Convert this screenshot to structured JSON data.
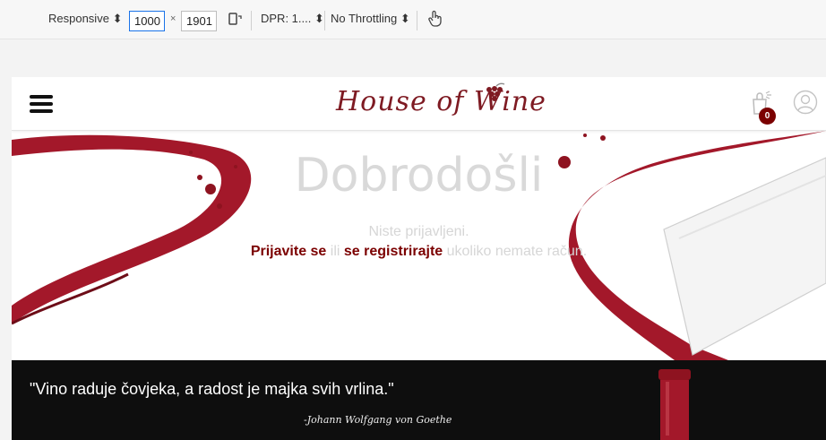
{
  "devtools": {
    "device": "Responsive",
    "width": "1000",
    "height": "1901",
    "times": "×",
    "dpr": "DPR: 1....",
    "throttling": "No Throttling"
  },
  "navbar": {
    "logo": "House of Wine",
    "cart_count": "0"
  },
  "hero": {
    "title": "Dobrodošli",
    "not_logged_in": "Niste prijavljeni.",
    "login_link": "Prijavite se",
    "or": " ili ",
    "register_link": "se registrirajte",
    "tail": " ukoliko nemate račun."
  },
  "quote": {
    "text": "\"Vino raduje čovjeka, a radost je majka svih vrlina.\"",
    "author": "-Johann Wolfgang von Goethe"
  },
  "colors": {
    "accent": "#7b0000",
    "logo": "#7e1a22",
    "wine": "#a3182a"
  }
}
